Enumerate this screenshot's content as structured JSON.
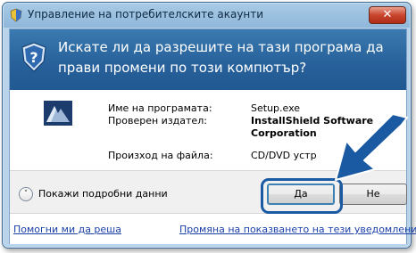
{
  "window": {
    "title": "Управление на потребителските акаунти",
    "close_label": "✕"
  },
  "banner": {
    "question": "Искате ли да разрешите на тази програма да прави промени по този компютър?"
  },
  "details": {
    "program_name_label": "Име на програмата:",
    "program_name_value": "Setup.exe",
    "publisher_label": "Проверен издател:",
    "publisher_value": "InstallShield Software Corporation",
    "origin_label": "Произход на файла:",
    "origin_value": "CD/DVD устр"
  },
  "actions": {
    "show_details_label": "Покажи подробни данни",
    "yes_label": "Да",
    "no_label": "Не"
  },
  "links": {
    "help_decide": "Помогни ми да реша",
    "change_notifications": "Промяна на показването на тези уведомления"
  },
  "colors": {
    "banner": "#27609a",
    "callout_arrow": "#1a5aa3"
  }
}
